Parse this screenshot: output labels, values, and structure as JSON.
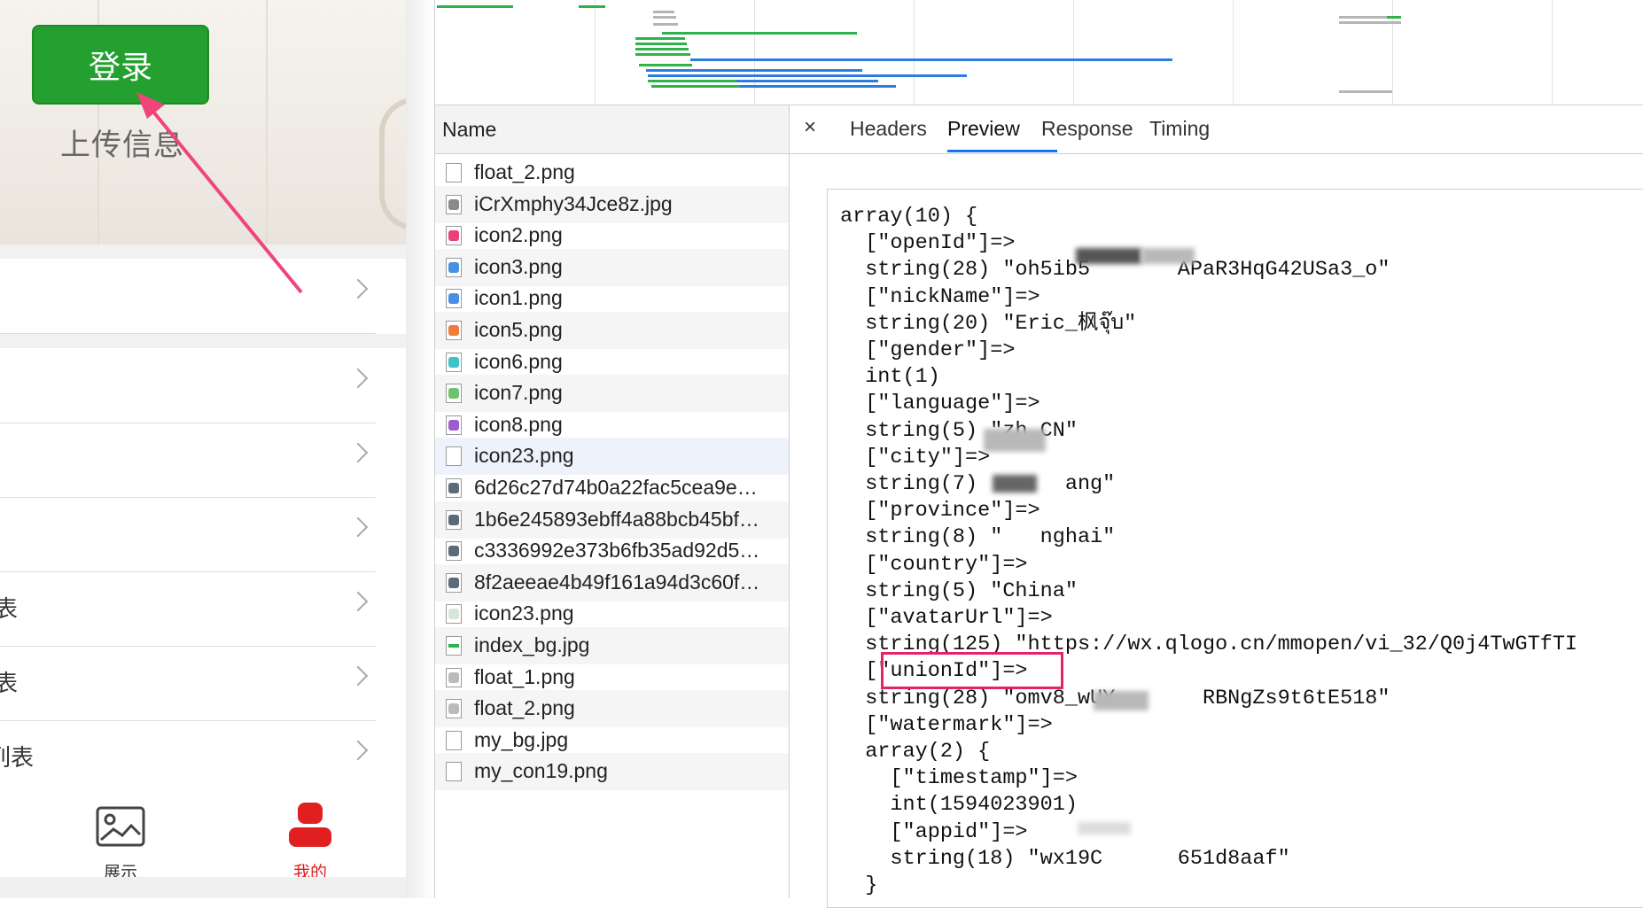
{
  "phone": {
    "login_label": "登录",
    "upload_info": "上传信息",
    "menu_items": [
      {
        "label": ""
      },
      {
        "label": ""
      },
      {
        "label": ""
      },
      {
        "label": ""
      },
      {
        "label": "表"
      },
      {
        "label": "表"
      },
      {
        "label": "列表"
      }
    ],
    "tabs": [
      {
        "label": "展示",
        "icon": "picture-icon",
        "active": false
      },
      {
        "label": "我的",
        "icon": "person-icon",
        "active": true
      }
    ],
    "colors": {
      "login": "#23a02f",
      "active_tab": "#e02020",
      "arrow": "#f0457a"
    }
  },
  "devtools": {
    "name_header": "Name",
    "files": [
      {
        "name": "float_2.png",
        "icon": "blank-file-icon"
      },
      {
        "name": "iCrXmphy34Jce8z.jpg",
        "icon": "image-file-icon"
      },
      {
        "name": "icon2.png",
        "icon": "pink-icon"
      },
      {
        "name": "icon3.png",
        "icon": "blue-icon"
      },
      {
        "name": "icon1.png",
        "icon": "blue-icon"
      },
      {
        "name": "icon5.png",
        "icon": "orange-icon"
      },
      {
        "name": "icon6.png",
        "icon": "teal-icon"
      },
      {
        "name": "icon7.png",
        "icon": "green-icon"
      },
      {
        "name": "icon8.png",
        "icon": "purple-icon"
      },
      {
        "name": "icon23.png",
        "icon": "blank-file-icon"
      },
      {
        "name": "6d26c27d74b0a22fac5cea9e…",
        "icon": "photo-icon"
      },
      {
        "name": "1b6e245893ebff4a88bcb45bf…",
        "icon": "photo-icon"
      },
      {
        "name": "c3336992e373b6fb35ad92d5…",
        "icon": "photo-icon"
      },
      {
        "name": "8f2aeeae4b49f161a94d3c60f…",
        "icon": "photo-icon"
      },
      {
        "name": "icon23.png",
        "icon": "faint-icon"
      },
      {
        "name": "index_bg.jpg",
        "icon": "green-bar-icon"
      },
      {
        "name": "float_1.png",
        "icon": "small-icon"
      },
      {
        "name": "float_2.png",
        "icon": "small-icon"
      },
      {
        "name": "my_bg.jpg",
        "icon": "blank-file-icon"
      },
      {
        "name": "my_con19.png",
        "icon": "blank-file-icon"
      }
    ],
    "tabs": {
      "close": "×",
      "headers": "Headers",
      "preview": "Preview",
      "response": "Response",
      "timing": "Timing"
    },
    "active_tab": "Preview",
    "preview_text": "array(10) {\n  [\"openId\"]=>\n  string(28) \"oh5ib5       APaR3HqG42USa3_o\"\n  [\"nickName\"]=>\n  string(20) \"Eric_枫จุ๊บ\"\n  [\"gender\"]=>\n  int(1)\n  [\"language\"]=>\n  string(5) \"zh_CN\"\n  [\"city\"]=>\n  string(7)       ang\"\n  [\"province\"]=>\n  string(8) \"   nghai\"\n  [\"country\"]=>\n  string(5) \"China\"\n  [\"avatarUrl\"]=>\n  string(125) \"https://wx.qlogo.cn/mmopen/vi_32/Q0j4TwGTfTI\n  [\"unionId\"]=>\n  string(28) \"omv8_wUY       RBNgZs9t6tE518\"\n  [\"watermark\"]=>\n  array(2) {\n    [\"timestamp\"]=>\n    int(1594023901)\n    [\"appid\"]=>\n    string(18) \"wx19C      651d8aaf\"\n  }"
  }
}
